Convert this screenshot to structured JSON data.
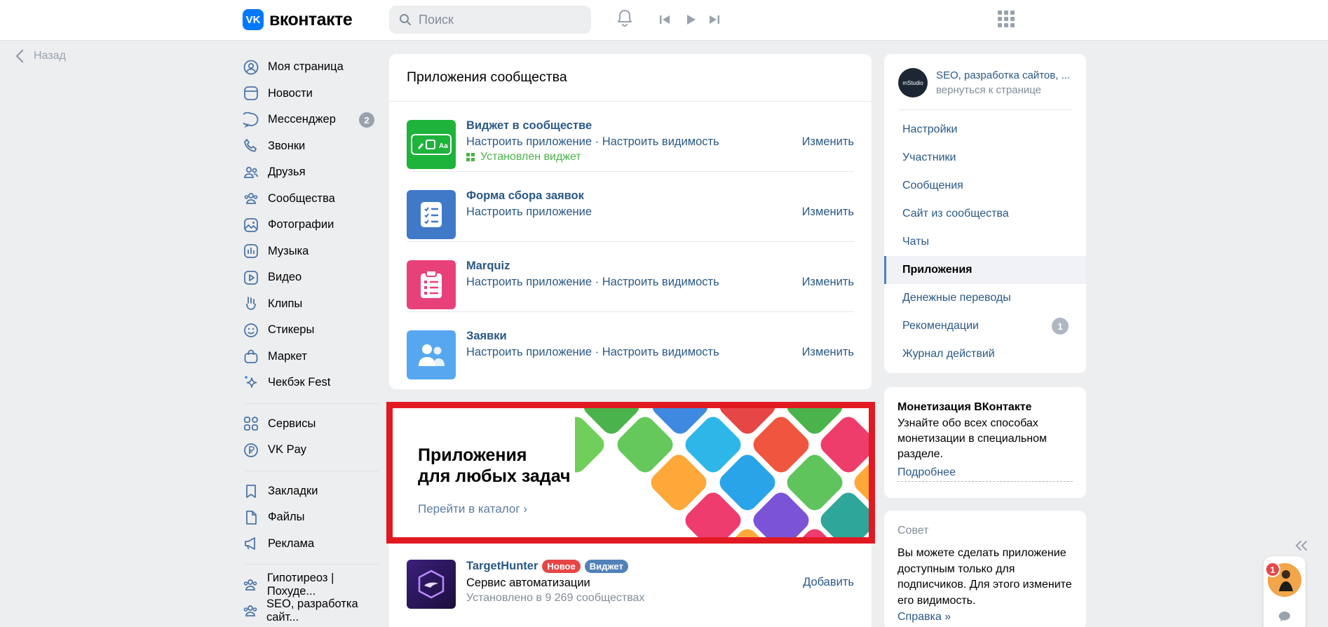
{
  "header": {
    "logo_mark": "VK",
    "logo_text": "вконтакте",
    "search_placeholder": "Поиск"
  },
  "back": {
    "label": "Назад"
  },
  "leftnav": {
    "items": [
      {
        "label": "Моя страница",
        "icon": "user-circle-icon"
      },
      {
        "label": "Новости",
        "icon": "news-icon"
      },
      {
        "label": "Мессенджер",
        "icon": "message-icon",
        "badge": "2"
      },
      {
        "label": "Звонки",
        "icon": "phone-icon"
      },
      {
        "label": "Друзья",
        "icon": "friends-icon"
      },
      {
        "label": "Сообщества",
        "icon": "communities-icon"
      },
      {
        "label": "Фотографии",
        "icon": "photo-icon"
      },
      {
        "label": "Музыка",
        "icon": "music-icon"
      },
      {
        "label": "Видео",
        "icon": "video-icon"
      },
      {
        "label": "Клипы",
        "icon": "clips-icon"
      },
      {
        "label": "Стикеры",
        "icon": "sticker-icon"
      },
      {
        "label": "Маркет",
        "icon": "market-icon"
      },
      {
        "label": "Чекбэк Fest",
        "icon": "sparkle-icon"
      }
    ],
    "items2": [
      {
        "label": "Сервисы",
        "icon": "services-icon"
      },
      {
        "label": "VK Pay",
        "icon": "vkpay-icon"
      }
    ],
    "items3": [
      {
        "label": "Закладки",
        "icon": "bookmark-icon"
      },
      {
        "label": "Файлы",
        "icon": "file-icon"
      },
      {
        "label": "Реклама",
        "icon": "megaphone-icon"
      }
    ],
    "items4": [
      {
        "label": "Гипотиреоз | Похуде...",
        "icon": "group-icon"
      },
      {
        "label": "SEO, разработка сайт...",
        "icon": "group-icon"
      }
    ]
  },
  "main": {
    "title": "Приложения сообщества",
    "apps": [
      {
        "title": "Виджет в сообществе",
        "sub": "Настроить приложение · Настроить видимость",
        "status": "Установлен виджет",
        "action": "Изменить",
        "color": "#1eb33a",
        "icon": "widget-icon"
      },
      {
        "title": "Форма сбора заявок",
        "sub": "Настроить приложение",
        "action": "Изменить",
        "color": "#3f79c8",
        "icon": "checklist-icon"
      },
      {
        "title": "Marquiz",
        "sub": "Настроить приложение · Настроить видимость",
        "action": "Изменить",
        "color": "#e8417a",
        "icon": "clipboard-icon"
      },
      {
        "title": "Заявки",
        "sub": "Настроить приложение · Настроить видимость",
        "action": "Изменить",
        "color": "#57a7f0",
        "icon": "people-icon"
      }
    ],
    "banner": {
      "title_line1": "Приложения",
      "title_line2": "для любых задач",
      "link": "Перейти в каталог ›"
    },
    "targethunter": {
      "title": "TargetHunter",
      "badge_new": "Новое",
      "badge_widget": "Виджет",
      "subtitle": "Сервис автоматизации",
      "installs": "Установлено в 9 269 сообществах",
      "action": "Добавить"
    }
  },
  "right": {
    "group_name_line1": "SEO, разработка сайтов, ...",
    "group_name_line2": "вернуться к странице",
    "group_avatar_text": "mStudio",
    "menu": [
      {
        "label": "Настройки"
      },
      {
        "label": "Участники"
      },
      {
        "label": "Сообщения"
      },
      {
        "label": "Сайт из сообщества"
      },
      {
        "label": "Чаты"
      },
      {
        "label": "Приложения",
        "active": true
      },
      {
        "label": "Денежные переводы"
      },
      {
        "label": "Рекомендации",
        "badge": "1"
      },
      {
        "label": "Журнал действий"
      }
    ],
    "monet": {
      "title": "Монетизация ВКонтакте",
      "text": "Узнайте обо всех способах монетизации в специальном разделе.",
      "link": "Подробнее"
    },
    "tip": {
      "title": "Совет",
      "text": "Вы можете сделать приложение доступным только для подписчиков. Для этого измените его видимость.",
      "link": "Справка »"
    }
  },
  "float_chat": {
    "badge": "1"
  },
  "colors": {
    "accent": "#0077ff",
    "link": "#2a5885",
    "highlight": "#e11a22"
  }
}
